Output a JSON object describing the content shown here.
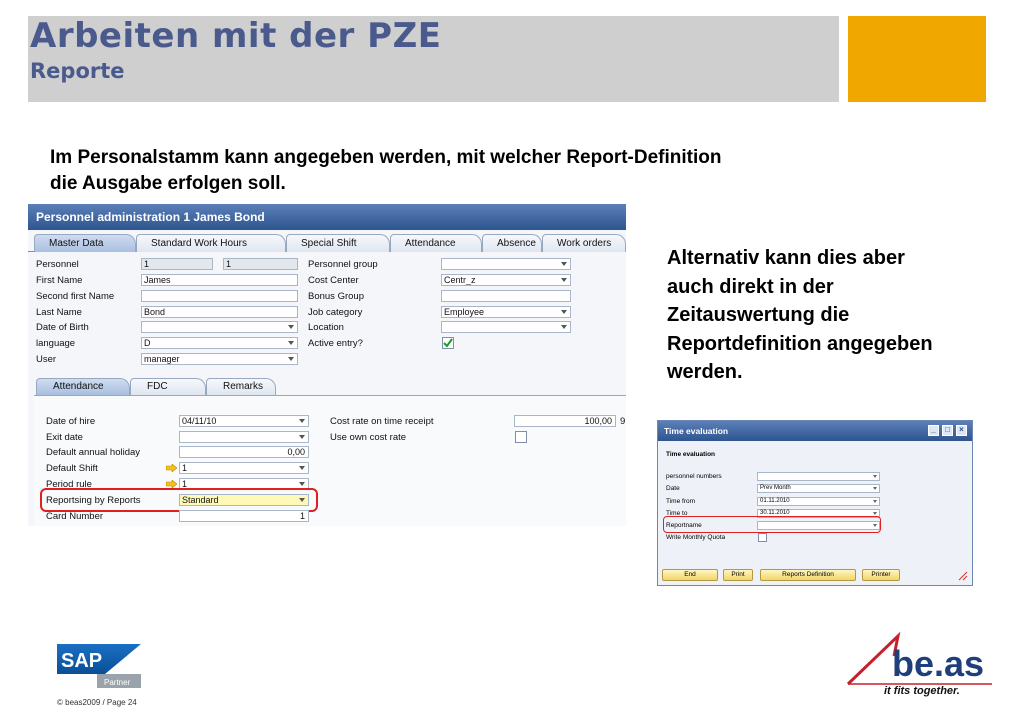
{
  "slide": {
    "title": "Arbeiten mit der PZE",
    "subtitle": "Reporte",
    "intro_line1": "Im Personalstamm kann angegeben werden, mit welcher Report-Definition",
    "intro_line2": "die Ausgabe erfolgen soll.",
    "alt_text": [
      "Alternativ kann dies aber",
      "auch direkt in der",
      "Zeitauswertung die",
      "Reportdefinition angegeben",
      "werden."
    ],
    "footer": "© beas2009 / Page 24",
    "colors": {
      "header_band": "#cfcfcf",
      "accent": "#f0a800",
      "title": "#4a5a8c",
      "highlight": "#e02020"
    }
  },
  "personnel_window": {
    "title": "Personnel administration 1 James Bond",
    "tabs": [
      "Master Data",
      "Standard Work Hours",
      "Special Shift",
      "Attendance",
      "Absence",
      "Work orders"
    ],
    "left_fields": [
      {
        "label": "Personnel",
        "value": "1",
        "value2": "1"
      },
      {
        "label": "First Name",
        "value": "James"
      },
      {
        "label": "Second first Name",
        "value": ""
      },
      {
        "label": "Last Name",
        "value": "Bond"
      },
      {
        "label": "Date of Birth",
        "value": ""
      },
      {
        "label": "language",
        "value": "D"
      },
      {
        "label": "User",
        "value": "manager"
      }
    ],
    "right_fields": [
      {
        "label": "Personnel group",
        "value": ""
      },
      {
        "label": "Cost Center",
        "value": "Centr_z"
      },
      {
        "label": "Bonus Group",
        "value": ""
      },
      {
        "label": "Job category",
        "value": "Employee"
      },
      {
        "label": "Location",
        "value": ""
      },
      {
        "label": "Active entry?",
        "value": "checked"
      }
    ],
    "subtabs": [
      "Attendance",
      "FDC",
      "Remarks"
    ],
    "attendance_fields": [
      {
        "label": "Date of hire",
        "value": "04/11/10"
      },
      {
        "label": "Exit date",
        "value": ""
      },
      {
        "label": "Default annual holiday",
        "value": "0,00"
      },
      {
        "label": "Default Shift",
        "value": "1"
      },
      {
        "label": "Period rule",
        "value": "1"
      },
      {
        "label": "Reportsing by Reports",
        "value": "Standard"
      },
      {
        "label": "Card Number",
        "value": "1"
      }
    ],
    "cost_rate": {
      "label": "Cost rate on time receipt",
      "value": "100,00",
      "suffix": "9"
    },
    "own_cost_rate": {
      "label": "Use own cost rate"
    }
  },
  "time_window": {
    "title": "Time evaluation",
    "section": "Time evaluation",
    "fields": [
      {
        "label": "personnel numbers",
        "value": ""
      },
      {
        "label": "Date",
        "value": "Prev Month"
      },
      {
        "label": "Time from",
        "value": "01.11.2010"
      },
      {
        "label": "Time to",
        "value": "30.11.2010"
      },
      {
        "label": "Reportname",
        "value": ""
      },
      {
        "label": "Write Monthly Quota",
        "value": ""
      }
    ],
    "buttons": [
      "End",
      "Print",
      "Reports Definition",
      "Printer"
    ]
  },
  "logos": {
    "sap": "SAP",
    "sap_partner": "Partner",
    "beas": "be.as",
    "beas_tagline": "it fits together."
  }
}
